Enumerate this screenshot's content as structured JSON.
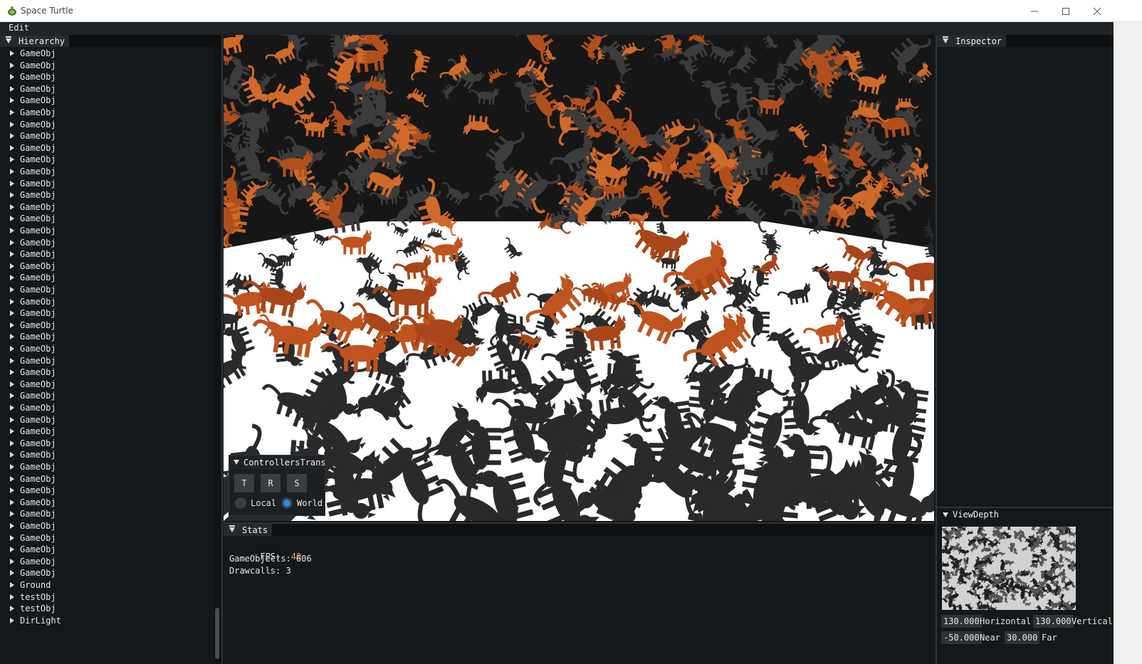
{
  "window": {
    "title": "Space Turtle",
    "controls": {
      "minimize": "minimize-icon",
      "maximize": "maximize-icon",
      "close": "close-icon"
    }
  },
  "menu": {
    "items": [
      "Edit"
    ]
  },
  "hierarchy": {
    "title": "Hierarchy",
    "items": [
      "GameObj",
      "GameObj",
      "GameObj",
      "GameObj",
      "GameObj",
      "GameObj",
      "GameObj",
      "GameObj",
      "GameObj",
      "GameObj",
      "GameObj",
      "GameObj",
      "GameObj",
      "GameObj",
      "GameObj",
      "GameObj",
      "GameObj",
      "GameObj",
      "GameObj",
      "GameObj",
      "GameObj",
      "GameObj",
      "GameObj",
      "GameObj",
      "GameObj",
      "GameObj",
      "GameObj",
      "GameObj",
      "GameObj",
      "GameObj",
      "GameObj",
      "GameObj",
      "GameObj",
      "GameObj",
      "GameObj",
      "GameObj",
      "GameObj",
      "GameObj",
      "GameObj",
      "GameObj",
      "GameObj",
      "GameObj",
      "GameObj",
      "GameObj",
      "GameObj",
      "Ground",
      "testObj",
      "testObj",
      "DirLight"
    ]
  },
  "controllers": {
    "title": "ControllersTransf",
    "buttons": [
      "T",
      "R",
      "S"
    ],
    "space_options": [
      "Local",
      "World"
    ],
    "selected_space": "World"
  },
  "stats": {
    "title": "Stats",
    "fps_label": "FPS:",
    "fps_value": "40",
    "gameobjects_line": "GameObjects: 606",
    "drawcalls_line": "Drawcalls: 3"
  },
  "inspector": {
    "title": "Inspector"
  },
  "viewdepth": {
    "title": "ViewDepth",
    "horizontal_value": "130.000",
    "horizontal_label": "Horizontal",
    "vertical_value": "130.000",
    "vertical_label": "Vertical",
    "near_value": "-50.000",
    "near_label": "Near",
    "far_value": "30.000",
    "far_label": "Far"
  },
  "colors": {
    "accent": "#1f8fe8",
    "fps": "#ff9a3c",
    "panel_bg": "#15181b",
    "cat_texture": "#c0541f",
    "shadow": "#2a2a2a",
    "ground": "#ffffff"
  }
}
